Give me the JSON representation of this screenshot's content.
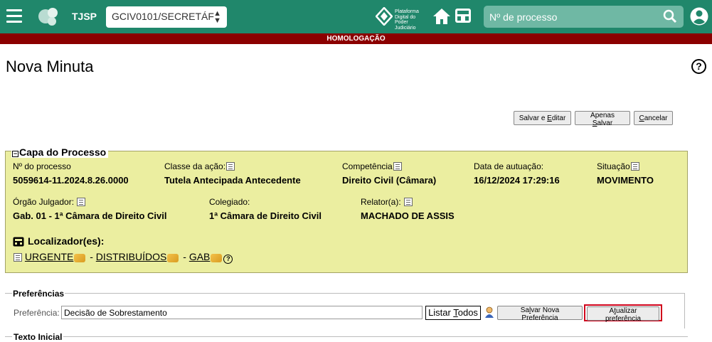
{
  "header": {
    "brand": "TJSP",
    "unit_select": "GCIV0101/SECRETÁF",
    "pdpj_lines": [
      "Plataforma",
      "Digital do",
      "Poder Judiciário"
    ],
    "search_placeholder": "Nº de processo"
  },
  "environment_banner": "HOMOLOGAÇÃO",
  "page": {
    "title": "Nova Minuta",
    "help": "?"
  },
  "actions": {
    "save_edit_pre": "Salvar e ",
    "save_edit_u": "E",
    "save_edit_post": "ditar",
    "save_only_pre": "Apenas ",
    "save_only_u": "S",
    "save_only_post": "alvar",
    "cancel_u": "C",
    "cancel_post": "ancelar"
  },
  "capa": {
    "legend": "Capa do Processo",
    "row1": [
      {
        "label": "Nº do processo",
        "value": "5059614-11.2024.8.26.0000"
      },
      {
        "label": "Classe da ação:",
        "value": "Tutela Antecipada Antecedente"
      },
      {
        "label": "Competência",
        "value": "Direito Civil (Câmara)"
      },
      {
        "label": "Data de autuação:",
        "value": "16/12/2024 17:29:16"
      },
      {
        "label": "Situação",
        "value": "MOVIMENTO"
      }
    ],
    "row2": [
      {
        "label": "Órgão Julgador:",
        "value": "Gab. 01 - 1ª Câmara de Direito Civil"
      },
      {
        "label": "Colegiado:",
        "value": "1ª Câmara de Direito Civil"
      },
      {
        "label": "Relator(a):",
        "value": "MACHADO DE ASSIS"
      }
    ],
    "localizadores_title": "Localizador(es):",
    "localizadores": [
      "URGENTE",
      "DISTRIBUÍDOS",
      "GAB"
    ],
    "separator": " - "
  },
  "preferencias": {
    "legend": "Preferências",
    "label": "Preferência:",
    "value": "Decisão de Sobrestamento",
    "listar_pre": "Listar ",
    "listar_u": "T",
    "listar_post": "odos",
    "save_new_pre": "Sa",
    "save_new_u": "l",
    "save_new_post": "var Nova Preferência",
    "update_pre": "A",
    "update_u": "t",
    "update_post": "ualizar preferência",
    "highlight_color": "#d0021b"
  },
  "texto_inicial": {
    "legend": "Texto Inicial"
  }
}
